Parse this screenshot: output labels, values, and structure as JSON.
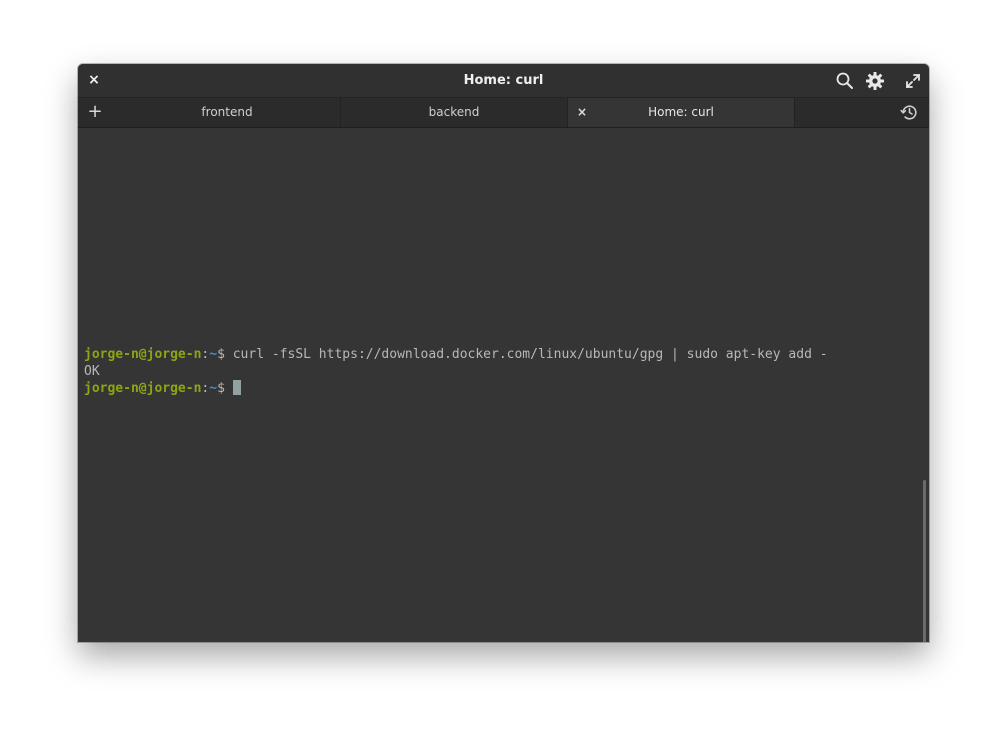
{
  "window": {
    "title": "Home: curl",
    "close_glyph": "×"
  },
  "titlebar_icons": {
    "search": "search-icon",
    "settings": "gear-icon",
    "fullscreen": "maximize-icon"
  },
  "tabs": {
    "add_glyph": "+",
    "items": [
      {
        "label": "frontend",
        "active": false
      },
      {
        "label": "backend",
        "active": false
      },
      {
        "label": "Home: curl",
        "active": true
      }
    ],
    "close_glyph": "×",
    "history_icon": "history-icon"
  },
  "terminal": {
    "lines": [
      {
        "user": "jorge-n@jorge-n",
        "colon": ":",
        "path": "~",
        "dollar": "$ ",
        "command": "curl -fsSL https://download.docker.com/linux/ubuntu/gpg | sudo apt-key add -"
      },
      {
        "output": "OK"
      },
      {
        "user": "jorge-n@jorge-n",
        "colon": ":",
        "path": "~",
        "dollar": "$ ",
        "command": ""
      }
    ]
  },
  "colors": {
    "background": "#353535",
    "prompt_user": "#8ea512",
    "prompt_path": "#3d91c2",
    "text": "#b8b8b8"
  }
}
